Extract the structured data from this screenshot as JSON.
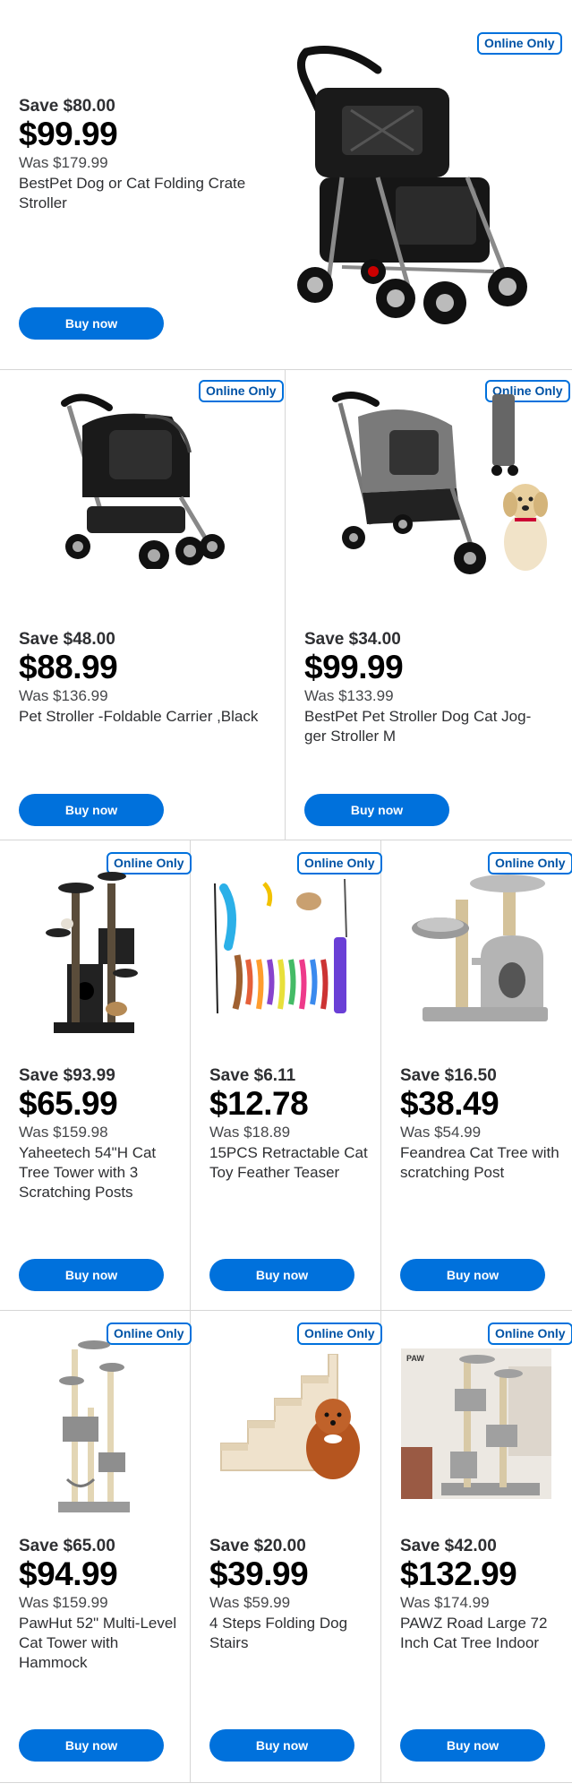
{
  "badge_label": "Online Only",
  "button_label": "Buy now",
  "colors": {
    "accent": "#0071dc",
    "badge_text": "#0053a6",
    "divider": "#d6d6d6"
  },
  "products": [
    {
      "save": "Save $80.00",
      "price": "$99.99",
      "was": "Was $179.99",
      "title": "BestPet Dog or Cat Folding Crate Stroller"
    },
    {
      "save": "Save $48.00",
      "price": "$88.99",
      "was": "Was $136.99",
      "title": "Pet Stroller -Foldable Carrier ,Black"
    },
    {
      "save": "Save $34.00",
      "price": "$99.99",
      "was": "Was $133.99",
      "title": "BestPet Pet Stroller Dog Cat Jog­ger Stroller M"
    },
    {
      "save": "Save $93.99",
      "price": "$65.99",
      "was": "Was $159.98",
      "title": "Yaheetech 54\"H Cat Tree Tower with 3 Scratching Posts"
    },
    {
      "save": "Save $6.11",
      "price": "$12.78",
      "was": "Was $18.89",
      "title": "15PCS Retractable Cat Toy Feather Teaser"
    },
    {
      "save": "Save $16.50",
      "price": "$38.49",
      "was": "Was $54.99",
      "title": "Feandrea Cat Tree with scratching Post"
    },
    {
      "save": "Save $65.00",
      "price": "$94.99",
      "was": "Was $159.99",
      "title": "PawHut 52\" Multi-Level Cat Tow­er with Hammock"
    },
    {
      "save": "Save $20.00",
      "price": "$39.99",
      "was": "Was $59.99",
      "title": "4 Steps Folding Dog Stairs"
    },
    {
      "save": "Save $42.00",
      "price": "$132.99",
      "was": "Was $174.99",
      "title": "PAWZ Road Large 72 Inch Cat Tree Indoor"
    }
  ]
}
